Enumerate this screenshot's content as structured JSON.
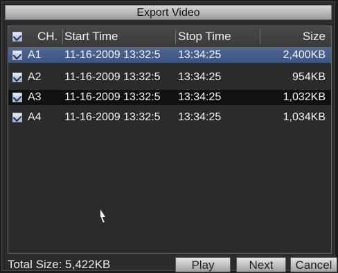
{
  "window": {
    "title": "Export Video"
  },
  "table": {
    "headers": {
      "channel": "CH.",
      "start_time": "Start Time",
      "stop_time": "Stop Time",
      "size": "Size"
    },
    "rows": [
      {
        "channel": "A1",
        "start_time": "11-16-2009 13:32:5",
        "stop_time": "13:34:25",
        "size": "2,400KB"
      },
      {
        "channel": "A2",
        "start_time": "11-16-2009 13:32:5",
        "stop_time": "13:34:25",
        "size": "954KB"
      },
      {
        "channel": "A3",
        "start_time": "11-16-2009 13:32:5",
        "stop_time": "13:34:25",
        "size": "1,032KB"
      },
      {
        "channel": "A4",
        "start_time": "11-16-2009 13:32:5",
        "stop_time": "13:34:25",
        "size": "1,034KB"
      }
    ]
  },
  "footer": {
    "total_size": "Total Size: 5,422KB"
  },
  "buttons": {
    "play": "Play",
    "next": "Next",
    "cancel": "Cancel"
  }
}
